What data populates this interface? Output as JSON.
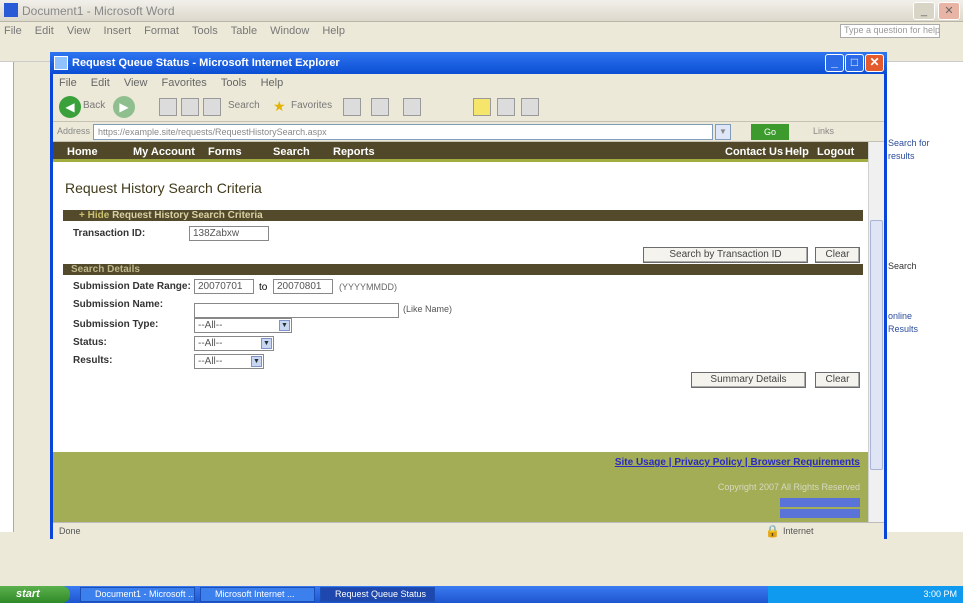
{
  "outer_window": {
    "title": "Document1 - Microsoft Word",
    "menu": [
      "File",
      "Edit",
      "View",
      "Insert",
      "Format",
      "Tools",
      "Table",
      "Window",
      "Help"
    ],
    "help_placeholder": "Type a question for help",
    "right_pane_items": [
      "Search for",
      "results",
      "Search",
      "online",
      "Results"
    ]
  },
  "ie_window": {
    "title": "Request Queue Status - Microsoft Internet Explorer",
    "menu": [
      "File",
      "Edit",
      "View",
      "Favorites",
      "Tools",
      "Help"
    ],
    "toolbar": {
      "back_label": "Back",
      "search_label": "Search",
      "favorites_label": "Favorites"
    },
    "address_label": "Address",
    "address_value": "https://example.site/requests/RequestHistorySearch.aspx",
    "go_label": "Go",
    "links_label": "Links",
    "status_text": "Done",
    "zone_text": "Internet"
  },
  "nav": {
    "items": [
      "Home",
      "My Account",
      "Forms",
      "Search",
      "Reports"
    ],
    "right_items": [
      "Contact Us",
      "Help",
      "Logout"
    ]
  },
  "page": {
    "title": "Request History Search Criteria",
    "section1": {
      "bar_prefix": "+ Hide",
      "bar_title": "Request History Search Criteria",
      "transaction_label": "Transaction ID:",
      "transaction_value": "138Zabxw",
      "search_button": "Search by Transaction ID",
      "clear_button": "Clear"
    },
    "section2": {
      "bar_title": "Search Details",
      "date_label": "Submission Date Range:",
      "date_from": "20070701",
      "date_to_label": "to",
      "date_to": "20070801",
      "date_format": "(YYYYMMDD)",
      "name_label": "Submission Name:",
      "name_hint": "(Like Name)",
      "type_label": "Submission Type:",
      "type_value": "--All--",
      "status_label": "Status:",
      "status_value": "--All--",
      "results_label": "Results:",
      "results_value": "--All--",
      "summary_button": "Summary Details",
      "clear_button": "Clear"
    },
    "footer": {
      "links": "Site Usage | Privacy Policy | Browser Requirements",
      "copyright": "Copyright 2007 All Rights Reserved"
    }
  },
  "taskbar": {
    "start_label": "start",
    "items": [
      "Document1 - Microsoft ...",
      "Microsoft Internet ...",
      "Request Queue Status"
    ],
    "clock": "3:00 PM"
  }
}
